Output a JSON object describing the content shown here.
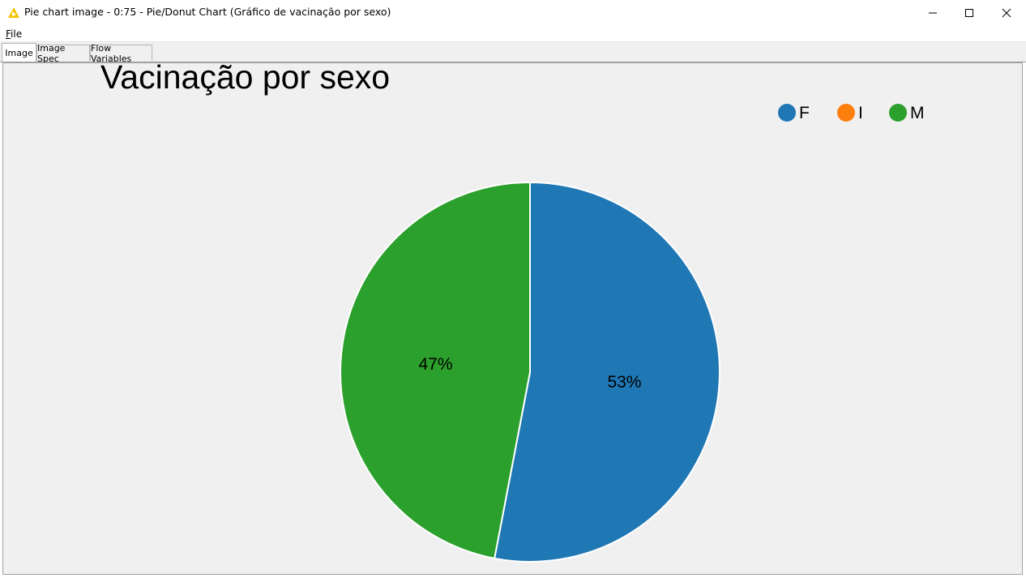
{
  "window": {
    "title": "Pie chart image - 0:75 - Pie/Donut Chart (Gráfico de vacinação por sexo)"
  },
  "menu": {
    "file_hotkey": "F",
    "file_rest": "ile"
  },
  "tabs": [
    {
      "label": "Image",
      "active": true
    },
    {
      "label": "Image Spec",
      "active": false
    },
    {
      "label": "Flow Variables",
      "active": false
    }
  ],
  "chart_data": {
    "type": "pie",
    "title": "Vacinação por sexo",
    "categories": [
      "F",
      "I",
      "M"
    ],
    "values": [
      53,
      0,
      47
    ],
    "labels": [
      "53%",
      "",
      "47%"
    ],
    "colors": [
      "#1f77b4",
      "#ff7f0e",
      "#2ca02c"
    ],
    "legend_position": "top-right"
  }
}
